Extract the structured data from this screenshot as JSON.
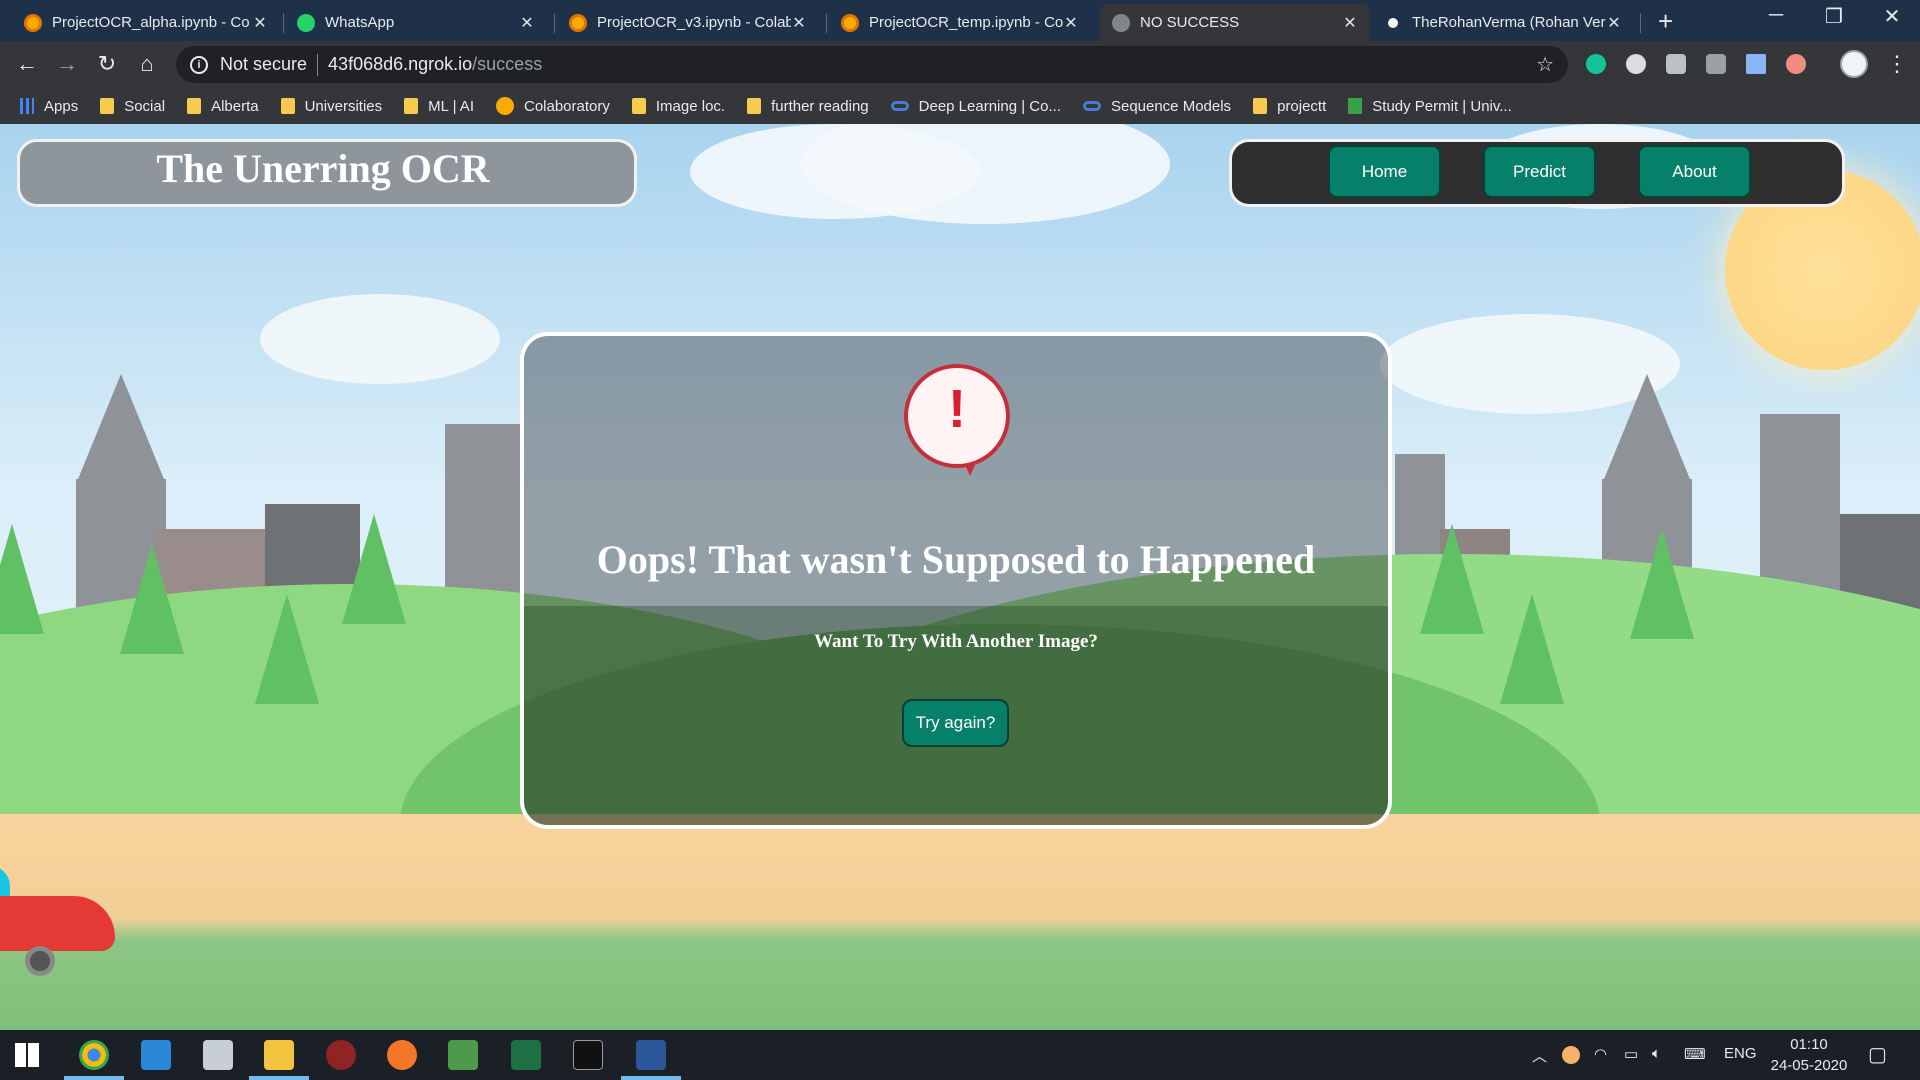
{
  "browser": {
    "tabs": [
      {
        "title": "ProjectOCR_alpha.ipynb - Co",
        "icon": "colab-icon",
        "active": false
      },
      {
        "title": "WhatsApp",
        "icon": "whatsapp-icon",
        "active": false
      },
      {
        "title": "ProjectOCR_v3.ipynb - Colab",
        "icon": "colab-icon",
        "active": false
      },
      {
        "title": "ProjectOCR_temp.ipynb - Co",
        "icon": "colab-icon",
        "active": false
      },
      {
        "title": "NO SUCCESS",
        "icon": "globe-icon",
        "active": true
      },
      {
        "title": "TheRohanVerma (Rohan Vern",
        "icon": "github-icon",
        "active": false
      }
    ],
    "address": {
      "security_label": "Not secure",
      "host": "43f068d6.ngrok.io",
      "path": "/success"
    },
    "bookmarks": [
      {
        "label": "Apps",
        "icon": "apps-grid-icon"
      },
      {
        "label": "Social",
        "icon": "folder-icon"
      },
      {
        "label": "Alberta",
        "icon": "folder-icon"
      },
      {
        "label": "Universities",
        "icon": "folder-icon"
      },
      {
        "label": "ML | AI",
        "icon": "folder-icon"
      },
      {
        "label": "Colaboratory",
        "icon": "colab-icon"
      },
      {
        "label": "Image loc.",
        "icon": "folder-icon"
      },
      {
        "label": "further reading",
        "icon": "folder-icon"
      },
      {
        "label": "Deep Learning | Co...",
        "icon": "deeplearning-icon"
      },
      {
        "label": "Sequence Models",
        "icon": "deeplearning-icon"
      },
      {
        "label": "projectt",
        "icon": "folder-icon"
      },
      {
        "label": "Study Permit | Univ...",
        "icon": "permit-icon"
      }
    ]
  },
  "app": {
    "title": "The Unerring OCR",
    "nav": [
      "Home",
      "Predict",
      "About"
    ]
  },
  "error_card": {
    "icon": "alert-bubble-icon",
    "mark": "!",
    "heading": "Oops! That wasn't Supposed to Happened",
    "subheading": "Want To Try With Another Image?",
    "button_label": "Try again?"
  },
  "taskbar": {
    "language": "ENG",
    "time": "01:10",
    "date": "24-05-2020"
  },
  "colors": {
    "accent": "#07806a",
    "error": "#c62f3a",
    "chrome_dark": "#35363a",
    "tabstrip": "#1f3148"
  }
}
